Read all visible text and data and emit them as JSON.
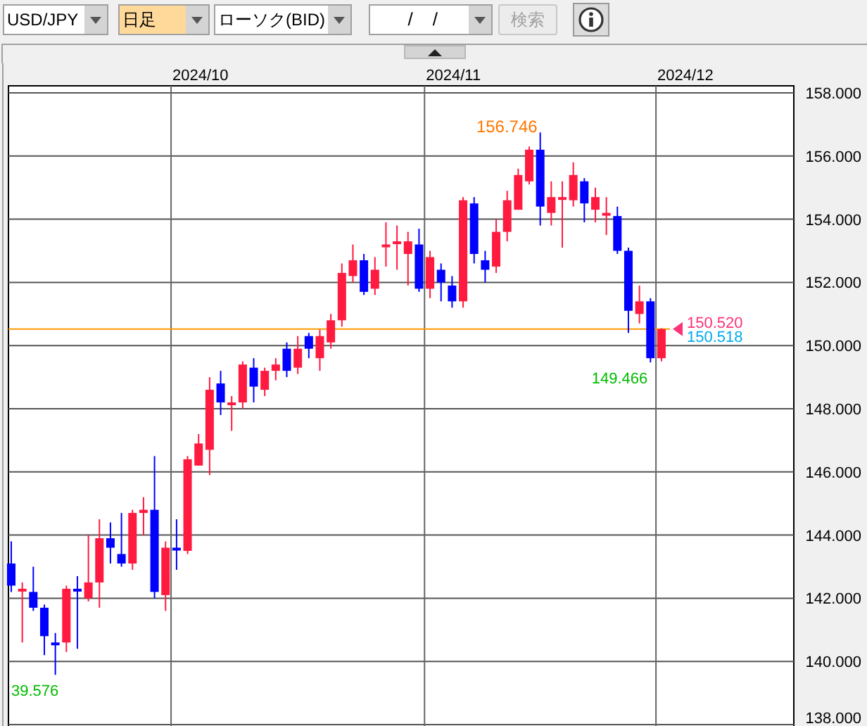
{
  "toolbar": {
    "symbol": "USD/JPY",
    "timeframe": "日足",
    "chart_type": "ローソク(BID)",
    "date": "/ /",
    "search_button": {
      "label": "検索",
      "disabled": true
    }
  },
  "chart": {
    "date_labels": [
      "2024/10",
      "2024/11",
      "2024/12"
    ],
    "price_labels": [
      "158.000",
      "156.000",
      "154.000",
      "152.000",
      "150.000",
      "148.000",
      "146.000",
      "144.000",
      "142.000",
      "140.000",
      "138.000"
    ],
    "high_label": "156.746",
    "low_labels": [
      "149.466",
      "39.576"
    ],
    "bid": "150.520",
    "ask": "150.518"
  }
}
